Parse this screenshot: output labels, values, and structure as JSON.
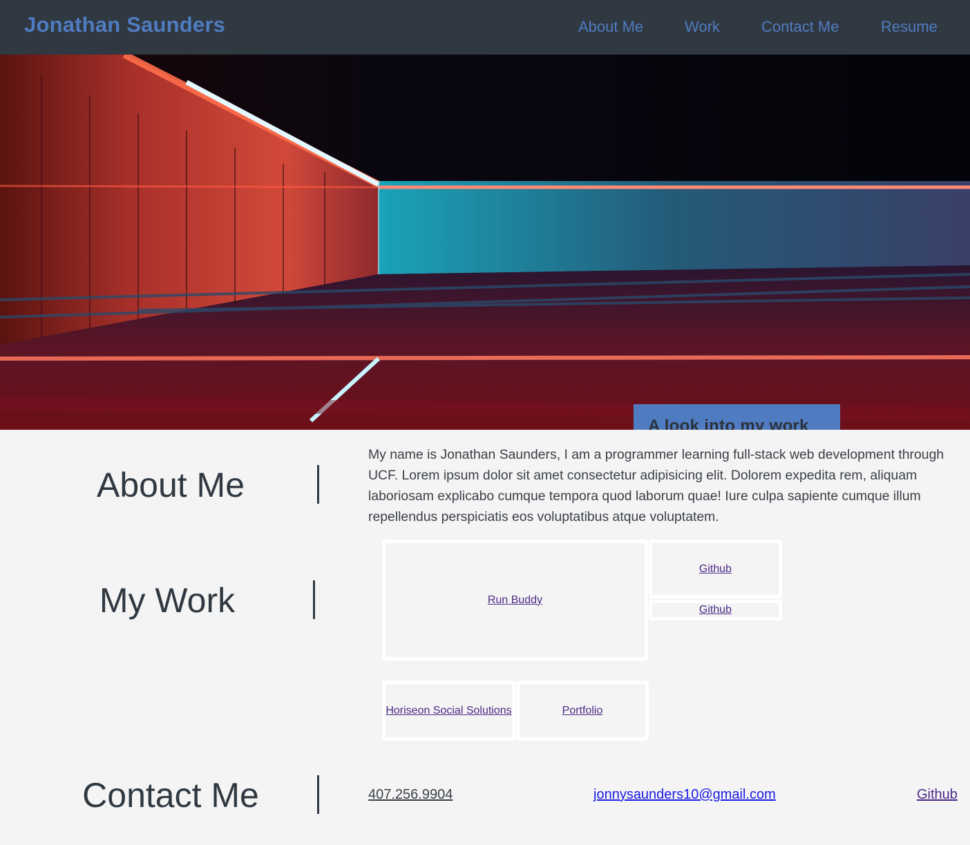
{
  "header": {
    "brand": "Jonathan Saunders",
    "nav": [
      "About Me",
      "Work",
      "Contact Me",
      "Resume"
    ]
  },
  "hero": {
    "button_label": "A look into my work"
  },
  "about": {
    "title": "About Me",
    "text": "My name is Jonathan Saunders, I am a programmer learning full-stack web development through UCF. Lorem ipsum dolor sit amet consectetur adipisicing elit. Dolorem expedita rem, aliquam laboriosam explicabo cumque tempora quod laborum quae! Iure culpa sapiente cumque illum repellendus perspiciatis eos voluptatibus atque voluptatem."
  },
  "work": {
    "title": "My Work",
    "projects": [
      "Run Buddy",
      "Github",
      "Github",
      "Horiseon Social Solutions",
      "Portfolio"
    ]
  },
  "contact": {
    "title": "Contact Me",
    "phone": "407.256.9904",
    "email": "jonnysaunders10@gmail.com",
    "github": "Github"
  },
  "colors": {
    "header_bg": "#303841",
    "accent": "#4f7cc1",
    "page_bg": "#f4f4f4",
    "visited_link": "#4b2a86",
    "email_link": "#1a1ae6"
  }
}
